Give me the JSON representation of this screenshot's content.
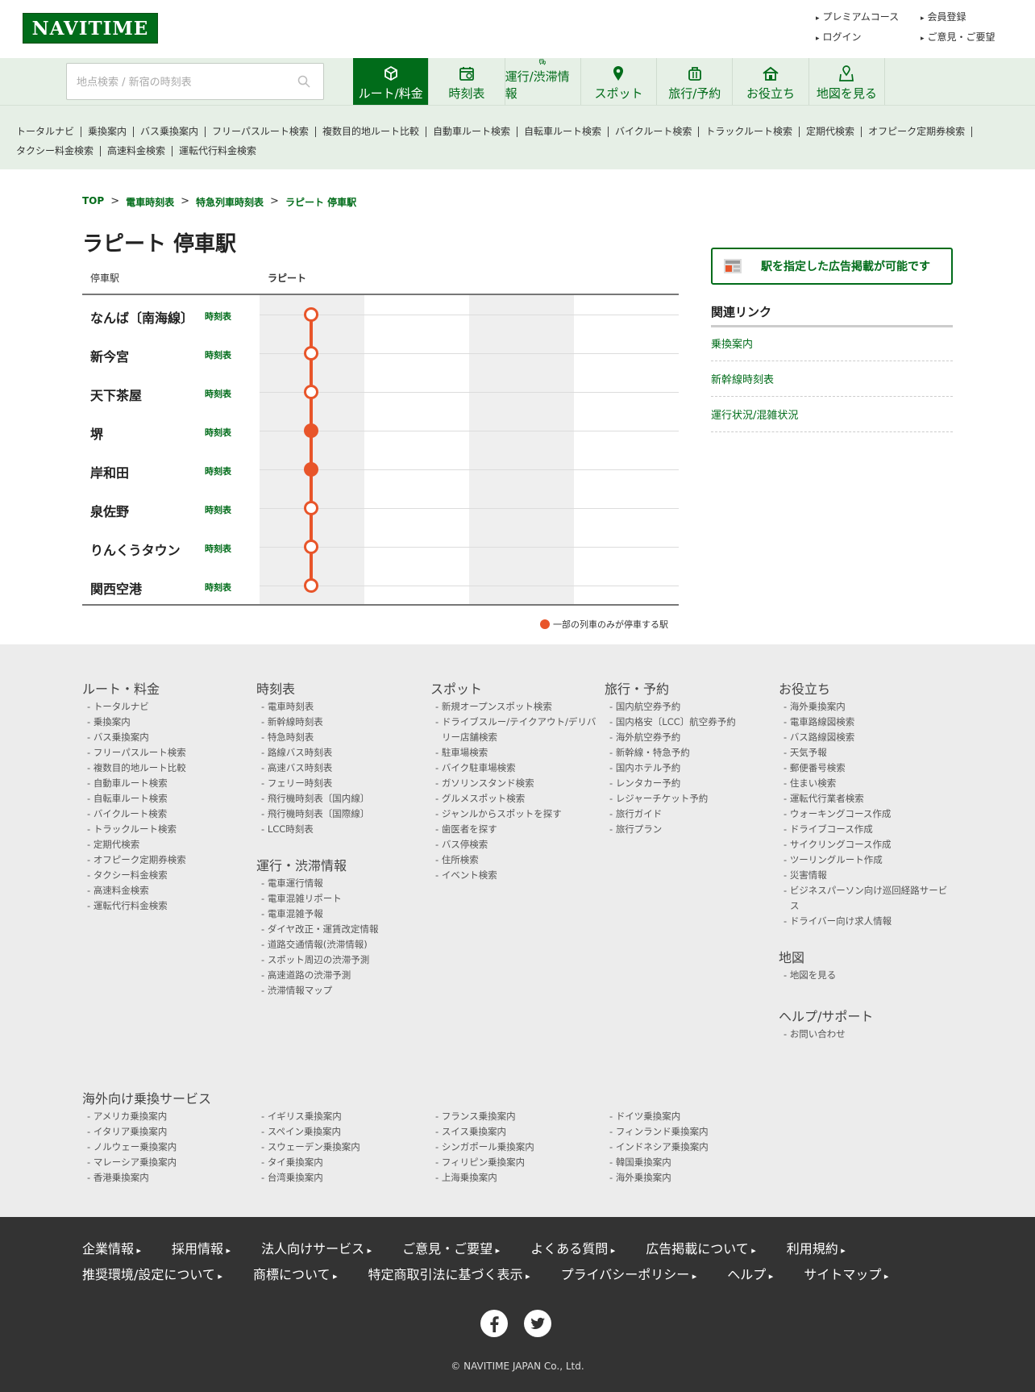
{
  "header": {
    "logo": "NAVITIME",
    "links": [
      "プレミアムコース",
      "会員登録",
      "ログイン",
      "ご意見・ご要望"
    ]
  },
  "search": {
    "placeholder": "地点検索 / 新宿の時刻表"
  },
  "nav": {
    "tabs": [
      {
        "label": "ルート/料金",
        "icon": "route-icon",
        "active": true
      },
      {
        "label": "時刻表",
        "icon": "calendar-icon",
        "active": false
      },
      {
        "label": "運行/渋滞情報",
        "icon": "traffic-icon",
        "active": false
      },
      {
        "label": "スポット",
        "icon": "pin-icon",
        "active": false
      },
      {
        "label": "旅行/予約",
        "icon": "suitcase-icon",
        "active": false
      },
      {
        "label": "お役立ち",
        "icon": "house-icon",
        "active": false
      },
      {
        "label": "地図を見る",
        "icon": "map-icon",
        "active": false
      }
    ]
  },
  "subnav": [
    "トータルナビ",
    "乗換案内",
    "バス乗換案内",
    "フリーパスルート検索",
    "複数目的地ルート比較",
    "自動車ルート検索",
    "自転車ルート検索",
    "バイクルート検索",
    "トラックルート検索",
    "定期代検索",
    "オフピーク定期券検索",
    "タクシー料金検索",
    "高速料金検索",
    "運転代行料金検索"
  ],
  "breadcrumb": [
    "TOP",
    "電車時刻表",
    "特急列車時刻表",
    "ラピート 停車駅"
  ],
  "page": {
    "title": "ラピート 停車駅",
    "col_station": "停車駅",
    "col_train": "ラピート",
    "timetable_label": "時刻表",
    "legend": "一部の列車のみが停車する駅"
  },
  "stations": [
    {
      "name": "なんば〔南海線〕",
      "partial_stop": false
    },
    {
      "name": "新今宮",
      "partial_stop": false
    },
    {
      "name": "天下茶屋",
      "partial_stop": false
    },
    {
      "name": "堺",
      "partial_stop": true
    },
    {
      "name": "岸和田",
      "partial_stop": true
    },
    {
      "name": "泉佐野",
      "partial_stop": false
    },
    {
      "name": "りんくうタウン",
      "partial_stop": false
    },
    {
      "name": "関西空港",
      "partial_stop": false
    }
  ],
  "side": {
    "ad_button": "駅を指定した広告掲載が可能です",
    "related_title": "関連リンク",
    "related": [
      "乗換案内",
      "新幹線時刻表",
      "運行状況/混雑状況"
    ]
  },
  "sitemap": {
    "route": {
      "title": "ルート・料金",
      "items": [
        "トータルナビ",
        "乗換案内",
        "バス乗換案内",
        "フリーパスルート検索",
        "複数目的地ルート比較",
        "自動車ルート検索",
        "自転車ルート検索",
        "バイクルート検索",
        "トラックルート検索",
        "定期代検索",
        "オフピーク定期券検索",
        "タクシー料金検索",
        "高速料金検索",
        "運転代行料金検索"
      ]
    },
    "timetable": {
      "title": "時刻表",
      "items": [
        "電車時刻表",
        "新幹線時刻表",
        "特急時刻表",
        "路線バス時刻表",
        "高速バス時刻表",
        "フェリー時刻表",
        "飛行機時刻表〔国内線〕",
        "飛行機時刻表〔国際線〕",
        "LCC時刻表"
      ]
    },
    "operation": {
      "title": "運行・渋滞情報",
      "items": [
        "電車運行情報",
        "電車混雑リポート",
        "電車混雑予報",
        "ダイヤ改正・運賃改定情報",
        "道路交通情報(渋滞情報)",
        "スポット周辺の渋滞予測",
        "高速道路の渋滞予測",
        "渋滞情報マップ"
      ]
    },
    "spot": {
      "title": "スポット",
      "items": [
        "新規オープンスポット検索",
        "ドライブスルー/テイクアウト/デリバリー店舗検索",
        "駐車場検索",
        "バイク駐車場検索",
        "ガソリンスタンド検索",
        "グルメスポット検索",
        "ジャンルからスポットを探す",
        "歯医者を探す",
        "バス停検索",
        "住所検索",
        "イベント検索"
      ]
    },
    "travel": {
      "title": "旅行・予約",
      "items": [
        "国内航空券予約",
        "国内格安〔LCC〕航空券予約",
        "海外航空券予約",
        "新幹線・特急予約",
        "国内ホテル予約",
        "レンタカー予約",
        "レジャーチケット予約",
        "旅行ガイド",
        "旅行プラン"
      ]
    },
    "useful": {
      "title": "お役立ち",
      "items": [
        "海外乗換案内",
        "電車路線図検索",
        "バス路線図検索",
        "天気予報",
        "郵便番号検索",
        "住まい検索",
        "運転代行業者検索",
        "ウォーキングコース作成",
        "ドライブコース作成",
        "サイクリングコース作成",
        "ツーリングルート作成",
        "災害情報",
        "ビジネスパーソン向け巡回経路サービス",
        "ドライバー向け求人情報"
      ]
    },
    "map": {
      "title": "地図",
      "items": [
        "地図を見る"
      ]
    },
    "help": {
      "title": "ヘルプ/サポート",
      "items": [
        "お問い合わせ"
      ]
    },
    "overseas": {
      "title": "海外向け乗換サービス",
      "cols": [
        [
          "アメリカ乗換案内",
          "イタリア乗換案内",
          "ノルウェー乗換案内",
          "マレーシア乗換案内",
          "香港乗換案内"
        ],
        [
          "イギリス乗換案内",
          "スペイン乗換案内",
          "スウェーデン乗換案内",
          "タイ乗換案内",
          "台湾乗換案内"
        ],
        [
          "フランス乗換案内",
          "スイス乗換案内",
          "シンガポール乗換案内",
          "フィリピン乗換案内",
          "上海乗換案内"
        ],
        [
          "ドイツ乗換案内",
          "フィンランド乗換案内",
          "インドネシア乗換案内",
          "韓国乗換案内",
          "海外乗換案内"
        ]
      ]
    }
  },
  "footer": {
    "row1": [
      "企業情報",
      "採用情報",
      "法人向けサービス",
      "ご意見・ご要望",
      "よくある質問",
      "広告掲載について",
      "利用規約"
    ],
    "row2": [
      "推奨環境/設定について",
      "商標について",
      "特定商取引法に基づく表示",
      "プライバシーポリシー",
      "ヘルプ",
      "サイトマップ"
    ],
    "copyright": "© NAVITIME JAPAN Co., Ltd."
  },
  "colors": {
    "brand": "#016c1a",
    "stop_line": "#e8552a",
    "footer_bg": "#333333",
    "sitemap_bg": "#ececec"
  }
}
